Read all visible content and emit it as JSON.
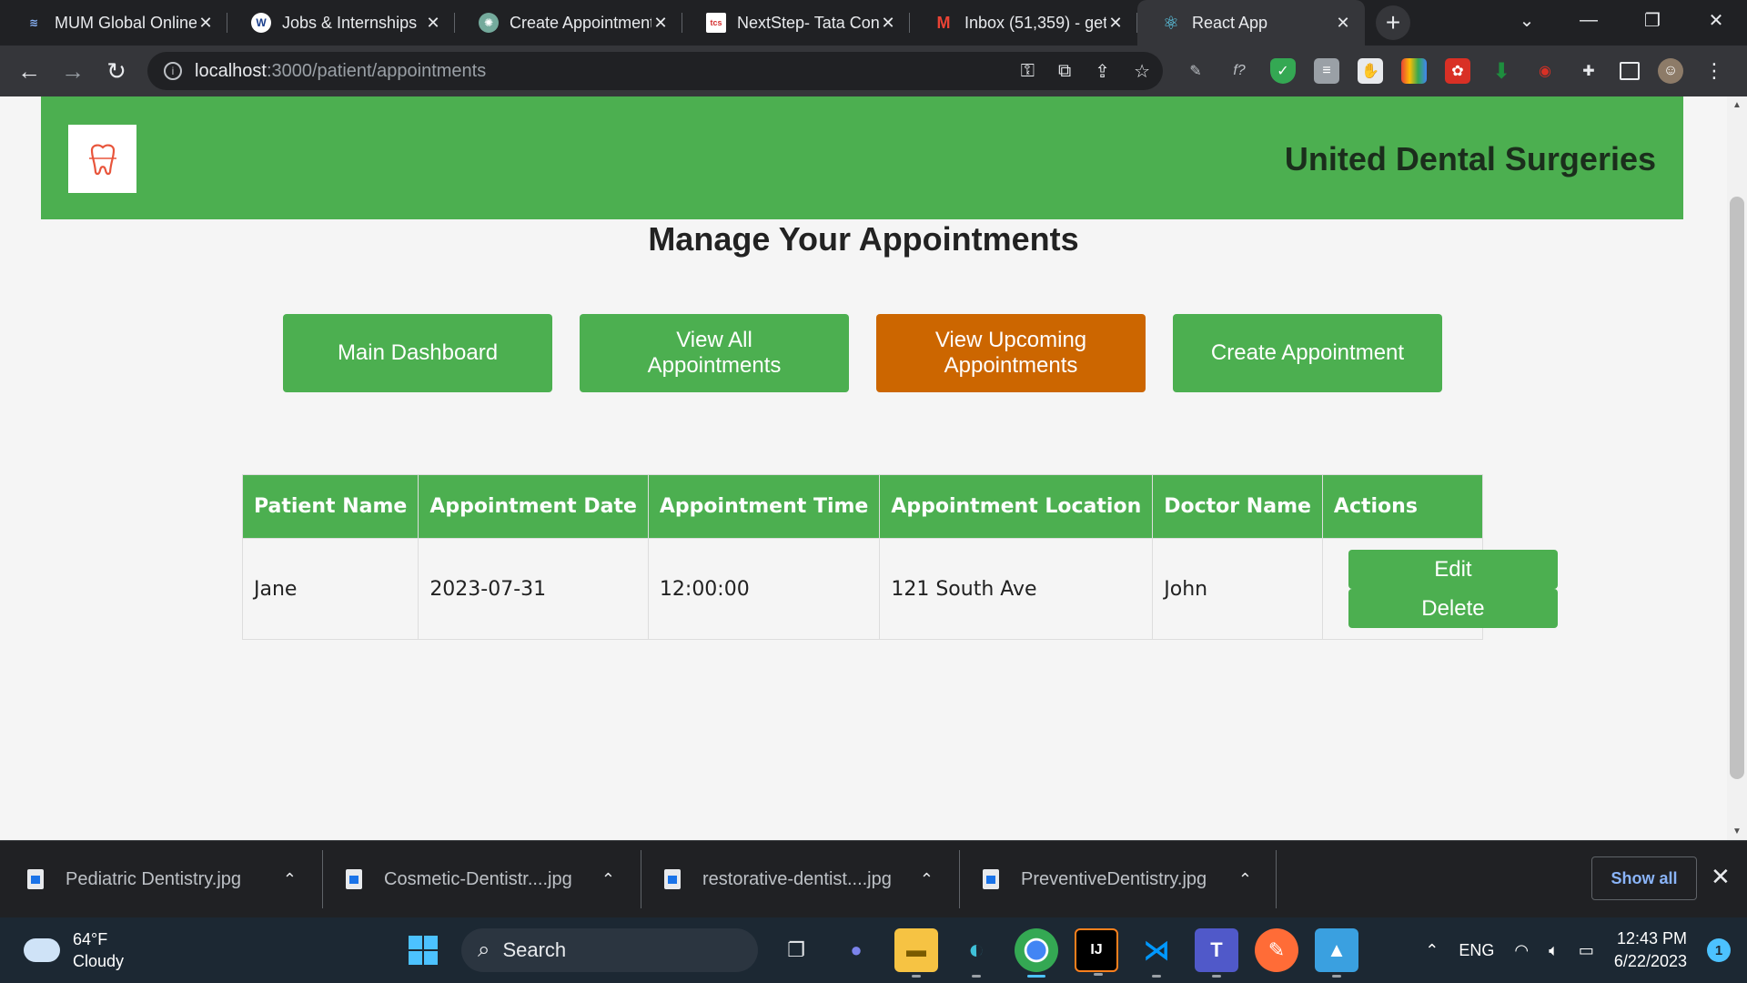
{
  "browser": {
    "tabs": [
      {
        "title": "MUM Global Online",
        "favicon": "mum-globe-icon",
        "color": "#8ab4f8"
      },
      {
        "title": "Jobs & Internships",
        "favicon": "w-logo-icon",
        "color": "#ffffff"
      },
      {
        "title": "Create Appointment",
        "favicon": "chatgpt-icon",
        "color": "#74aa9c"
      },
      {
        "title": "NextStep- Tata Con",
        "favicon": "tcs-icon",
        "color": "#ffffff"
      },
      {
        "title": "Inbox (51,359) - get",
        "favicon": "gmail-icon",
        "color": "#ea4335"
      },
      {
        "title": "React App",
        "favicon": "react-icon",
        "color": "#61dafb",
        "active": true
      }
    ],
    "url_host": "localhost",
    "url_path": ":3000/patient/appointments"
  },
  "header": {
    "site_name": "United Dental Surgeries",
    "logo_color": "#e8553b"
  },
  "page": {
    "title": "Manage Your Appointments"
  },
  "nav_buttons": [
    {
      "label": "Main Dashboard",
      "active": false
    },
    {
      "label": "View All Appointments",
      "active": false
    },
    {
      "label": "View Upcoming Appointments",
      "active": true
    },
    {
      "label": "Create Appointment",
      "active": false
    }
  ],
  "table": {
    "columns": [
      "Patient Name",
      "Appointment Date",
      "Appointment Time",
      "Appointment Location",
      "Doctor Name",
      "Actions"
    ],
    "rows": [
      {
        "patient": "Jane",
        "date": "2023-07-31",
        "time": "12:00:00",
        "location": "121 South Ave",
        "doctor": "John"
      }
    ],
    "edit_label": "Edit",
    "delete_label": "Delete"
  },
  "downloads": {
    "items": [
      "Pediatric Dentistry.jpg",
      "Cosmetic-Dentistr....jpg",
      "restorative-dentist....jpg",
      "PreventiveDentistry.jpg"
    ],
    "show_all": "Show all"
  },
  "taskbar": {
    "temperature": "64°F",
    "weather": "Cloudy",
    "search_label": "Search",
    "language": "ENG",
    "time": "12:43 PM",
    "date": "6/22/2023",
    "notification_count": "1"
  },
  "colors": {
    "brand_green": "#4caf50",
    "active_orange": "#cc6600"
  }
}
